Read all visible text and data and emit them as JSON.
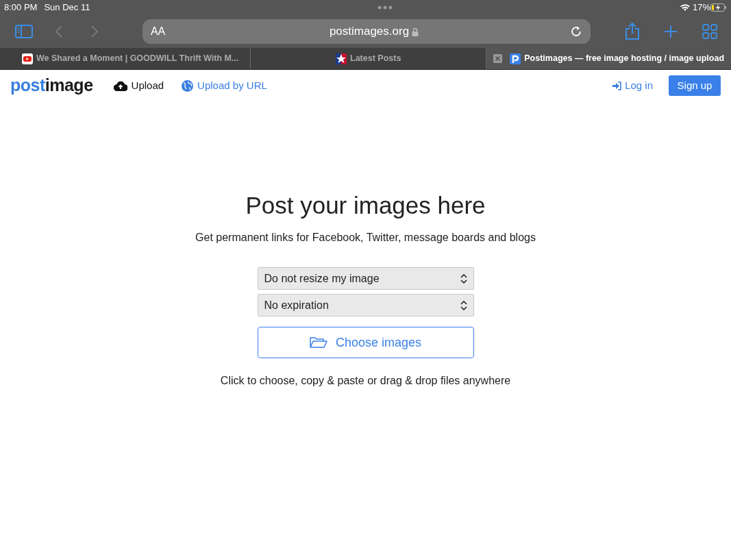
{
  "status_bar": {
    "time": "8:00 PM",
    "date": "Sun Dec 11",
    "battery": "17%"
  },
  "address_bar": {
    "text_size": "AA",
    "url": "postimages.org"
  },
  "tabs": [
    {
      "title": "We Shared a Moment | GOODWILL Thrift With M...",
      "kind": "video",
      "selected": false
    },
    {
      "title": "Latest Posts",
      "kind": "star",
      "selected": false
    },
    {
      "title": "Postimages — free image hosting / image upload",
      "kind": "p",
      "selected": true
    }
  ],
  "nav": {
    "logo_a": "post",
    "logo_b": "image",
    "links": [
      {
        "label": "Upload",
        "kind": "upload"
      },
      {
        "label": "Upload by URL",
        "kind": "url"
      }
    ],
    "login": "Log in",
    "signup": "Sign up"
  },
  "main": {
    "heading": "Post your images here",
    "subheading": "Get permanent links for Facebook, Twitter, message boards and blogs",
    "selects": [
      {
        "value": "Do not resize my image"
      },
      {
        "value": "No expiration"
      }
    ],
    "choose_button": "Choose images",
    "hint": "Click to choose, copy & paste or drag & drop files anywhere"
  }
}
